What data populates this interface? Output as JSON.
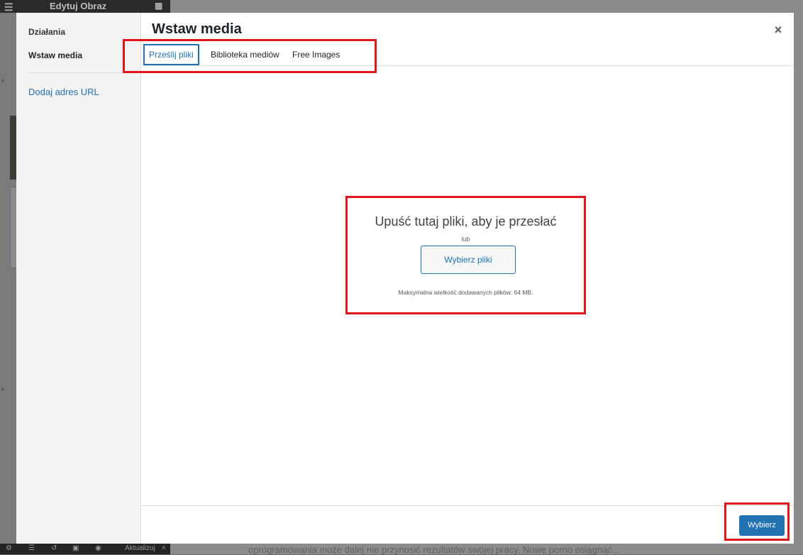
{
  "editor": {
    "title": "Edytuj Obraz",
    "bottombar_update": "Aktualizuj",
    "page_text": "oprogramowania może dalej nie przynosić rezultatów swojej pracy. Nowe porno osiągnąć..."
  },
  "modal": {
    "menu": {
      "heading": "Działania",
      "active_item": "Wstaw media",
      "insert_url": "Dodaj adres URL"
    },
    "title": "Wstaw media",
    "close_glyph": "×",
    "tabs": [
      {
        "label": "Prześlij pliki",
        "active": true
      },
      {
        "label": "Biblioteka mediów",
        "active": false
      },
      {
        "label": "Free Images",
        "active": false
      }
    ],
    "uploader": {
      "instructions": "Upuść tutaj pliki, aby je przesłać",
      "or": "lub",
      "select_files": "Wybierz pliki",
      "max_size": "Maksymalna wielkość dodawanych plików: 64 MB."
    },
    "select_button": "Wybierz"
  },
  "colors": {
    "accent": "#2271b1",
    "annotation": "#e0161d"
  },
  "icons": {
    "close": "close-icon",
    "menu": "hamburger-icon",
    "apps": "grid-icon"
  }
}
